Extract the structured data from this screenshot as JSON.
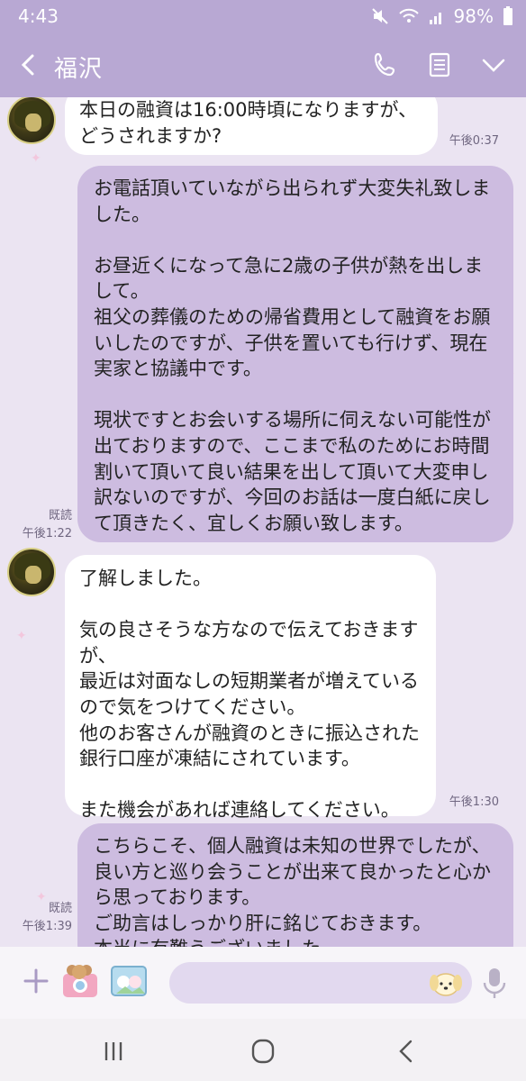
{
  "status_bar": {
    "time": "4:43",
    "battery": "98%",
    "icons": [
      "mute-icon",
      "wifi-icon",
      "signal-icon",
      "battery-icon"
    ]
  },
  "header": {
    "title": "福沢",
    "icons": [
      "back-arrow-icon",
      "phone-icon",
      "notes-icon",
      "chevron-down-icon"
    ],
    "background": "#b8a8d3"
  },
  "messages": [
    {
      "side": "incoming",
      "text": "本日の融資は16:00時頃になりますが、どうされますか?",
      "time": "午後0:37"
    },
    {
      "side": "outgoing",
      "text": "お電話頂いていながら出られず大変失礼致しました。\n\nお昼近くになって急に2歳の子供が熱を出しまして。\n祖父の葬儀のための帰省費用として融資をお願いしたのですが、子供を置いても行けず、現在実家と協議中です。\n\n現状ですとお会いする場所に伺えない可能性が出ておりますので、ここまで私のためにお時間割いて頂いて良い結果を出して頂いて大変申し訳ないのですが、今回のお話は一度白紙に戻して頂きたく、宜しくお願い致します。",
      "read": "既読",
      "time": "午後1:22"
    },
    {
      "side": "incoming",
      "text": "了解しました。\n\n気の良さそうな方なので伝えておきますが、\n最近は対面なしの短期業者が増えているので気をつけてください。\n他のお客さんが融資のときに振込された銀行口座が凍結にされています。\n\nまた機会があれば連絡してください。",
      "time": "午後1:30"
    },
    {
      "side": "outgoing",
      "text": "こちらこそ、個人融資は未知の世界でしたが、良い方と巡り会うことが出来て良かったと心から思っております。\nご助言はしっかり肝に銘じておきます。\n本当に有難うございました。",
      "read": "既読",
      "time": "午後1:39"
    }
  ],
  "input": {
    "placeholder": "",
    "icons": [
      "plus-icon",
      "camera-sticker-icon",
      "gallery-sticker-icon",
      "puppy-sticker-icon",
      "microphone-icon"
    ]
  },
  "nav_bar": {
    "icons": [
      "recent-apps-icon",
      "home-icon",
      "back-icon"
    ]
  },
  "colors": {
    "outgoing_bubble": "#cdbce0",
    "incoming_bubble": "#ffffff",
    "chat_background": "#ebe4f2"
  }
}
